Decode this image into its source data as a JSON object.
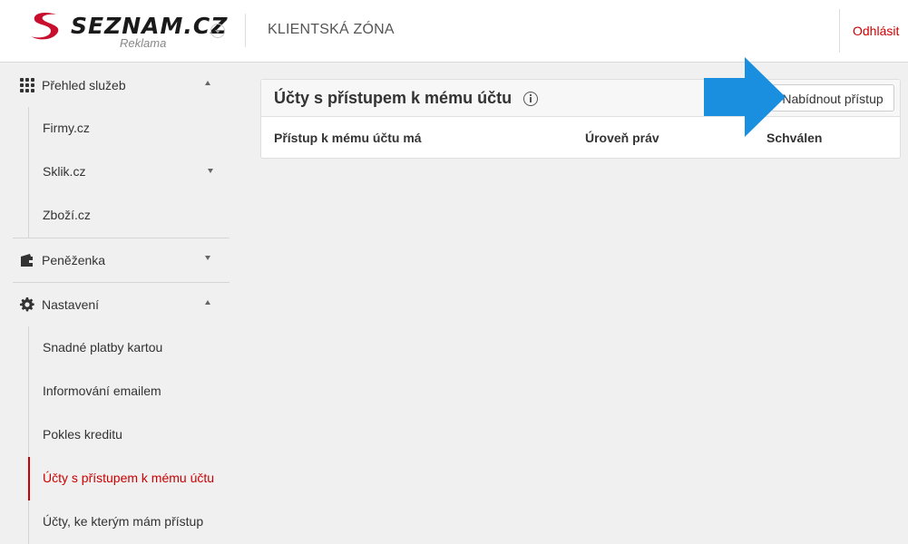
{
  "header": {
    "logo_text": "SEZNAM.CZ",
    "logo_sub": "Reklama",
    "title": "KLIENTSKÁ ZÓNA",
    "logout": "Odhlásit"
  },
  "sidebar": {
    "sections": [
      {
        "label": "Přehled služeb",
        "icon": "grid-icon",
        "expanded": true,
        "items": [
          {
            "label": "Firmy.cz"
          },
          {
            "label": "Sklik.cz",
            "has_children": true
          },
          {
            "label": "Zboží.cz"
          }
        ]
      },
      {
        "label": "Peněženka",
        "icon": "wallet-icon",
        "expanded": false
      },
      {
        "label": "Nastavení",
        "icon": "gear-icon",
        "expanded": true,
        "items": [
          {
            "label": "Snadné platby kartou"
          },
          {
            "label": "Informování emailem"
          },
          {
            "label": "Pokles kreditu"
          },
          {
            "label": "Účty s přístupem k mému účtu",
            "active": true
          },
          {
            "label": "Účty, ke kterým mám přístup"
          }
        ]
      }
    ]
  },
  "main": {
    "card_title": "Účty s přístupem k mému účtu",
    "offer_button": "Nabídnout přístup",
    "columns": [
      "Přístup k mému účtu má",
      "Úroveň práv",
      "Schválen"
    ]
  },
  "colors": {
    "accent": "#cc0000",
    "arrow": "#1a8fe0"
  }
}
